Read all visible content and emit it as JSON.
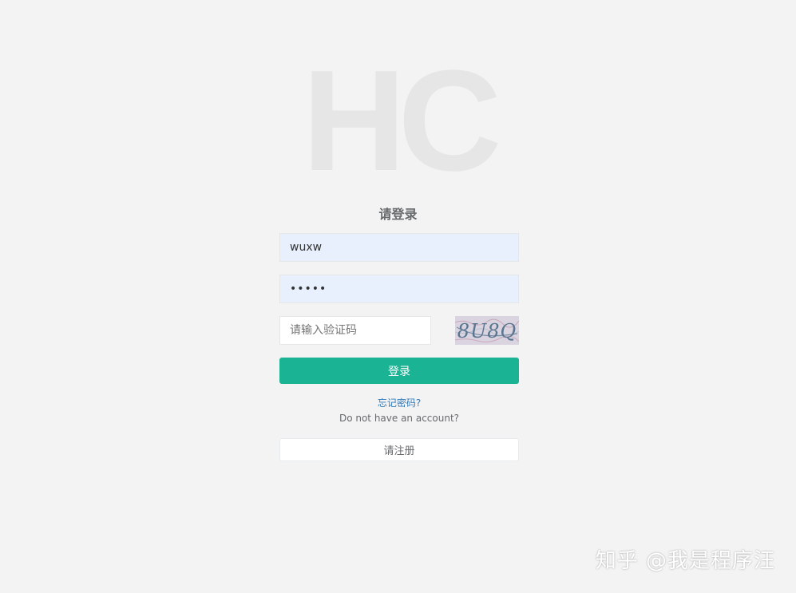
{
  "logo": {
    "text": "HC"
  },
  "title": "请登录",
  "username": {
    "value": "wuxw"
  },
  "password": {
    "value": "wuxw1"
  },
  "captcha": {
    "placeholder": "请输入验证码",
    "image_text": "8U8Q"
  },
  "buttons": {
    "login": "登录",
    "register": "请注册"
  },
  "links": {
    "forgot_password": "忘记密码?"
  },
  "messages": {
    "no_account": "Do not have an account?"
  },
  "watermark": "知乎 @我是程序汪",
  "colors": {
    "primary": "#1ab394",
    "link": "#337ab7",
    "background": "#f3f3f3",
    "autofill": "#e8f0fe"
  }
}
